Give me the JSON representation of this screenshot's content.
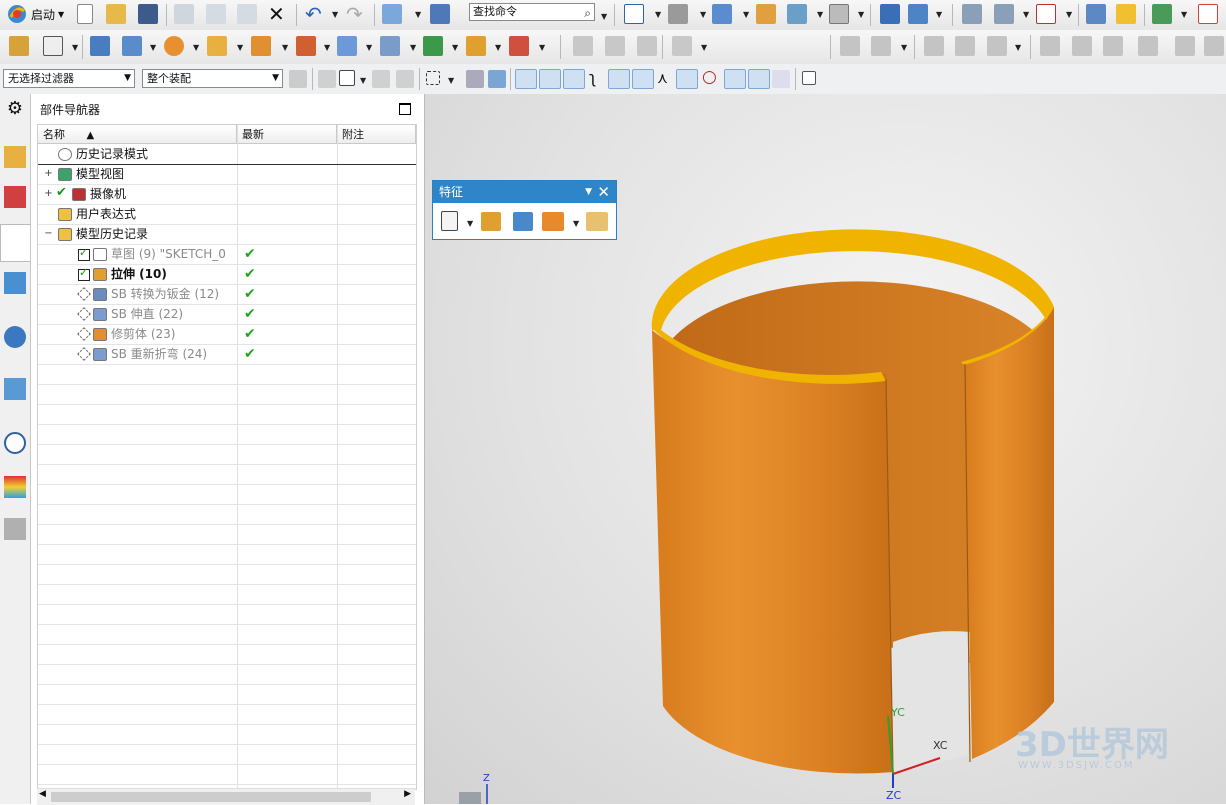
{
  "toolbar": {
    "start_label": "启动",
    "search_placeholder": "查找命令"
  },
  "selection_bar": {
    "filter_value": "无选择过滤器",
    "scope_value": "整个装配"
  },
  "navigator": {
    "title": "部件导航器",
    "columns": [
      "名称",
      "最新",
      "附注"
    ],
    "rows": [
      {
        "label": "历史记录模式",
        "icon": "clock-icon",
        "style": "normal"
      },
      {
        "label": "模型视图",
        "icon": "model-views-icon",
        "style": "normal"
      },
      {
        "label": "摄像机",
        "icon": "camera-icon",
        "style": "normal"
      },
      {
        "label": "用户表达式",
        "icon": "folder-icon",
        "style": "normal"
      },
      {
        "label": "模型历史记录",
        "icon": "folder-open-icon",
        "style": "normal"
      },
      {
        "label": "草图 (9) \"SKETCH_0",
        "icon": "sketch-icon",
        "style": "gray",
        "latest": "✔"
      },
      {
        "label": "拉伸 (10)",
        "icon": "extrude-icon",
        "style": "bold",
        "latest": "✔"
      },
      {
        "label": "SB 转换为钣金 (12)",
        "icon": "convert-sheetmetal-icon",
        "style": "gray",
        "latest": "✔"
      },
      {
        "label": "SB 伸直 (22)",
        "icon": "unbend-icon",
        "style": "gray",
        "latest": "✔"
      },
      {
        "label": "修剪体 (23)",
        "icon": "trim-body-icon",
        "style": "gray",
        "latest": "✔"
      },
      {
        "label": "SB 重新折弯 (24)",
        "icon": "rebend-icon",
        "style": "gray",
        "latest": "✔"
      }
    ]
  },
  "feature_panel": {
    "title": "特征",
    "menu_glyph": "▼",
    "close_glyph": "✕"
  },
  "viewport": {
    "axis_labels": {
      "yc": "YC",
      "xc": "XC",
      "zc": "ZC",
      "z": "Z"
    },
    "watermark": "3D世界网",
    "watermark_sub": "WWW.3DSJW.COM",
    "model_color": "#e08a2c",
    "rim_color": "#f0b400"
  }
}
